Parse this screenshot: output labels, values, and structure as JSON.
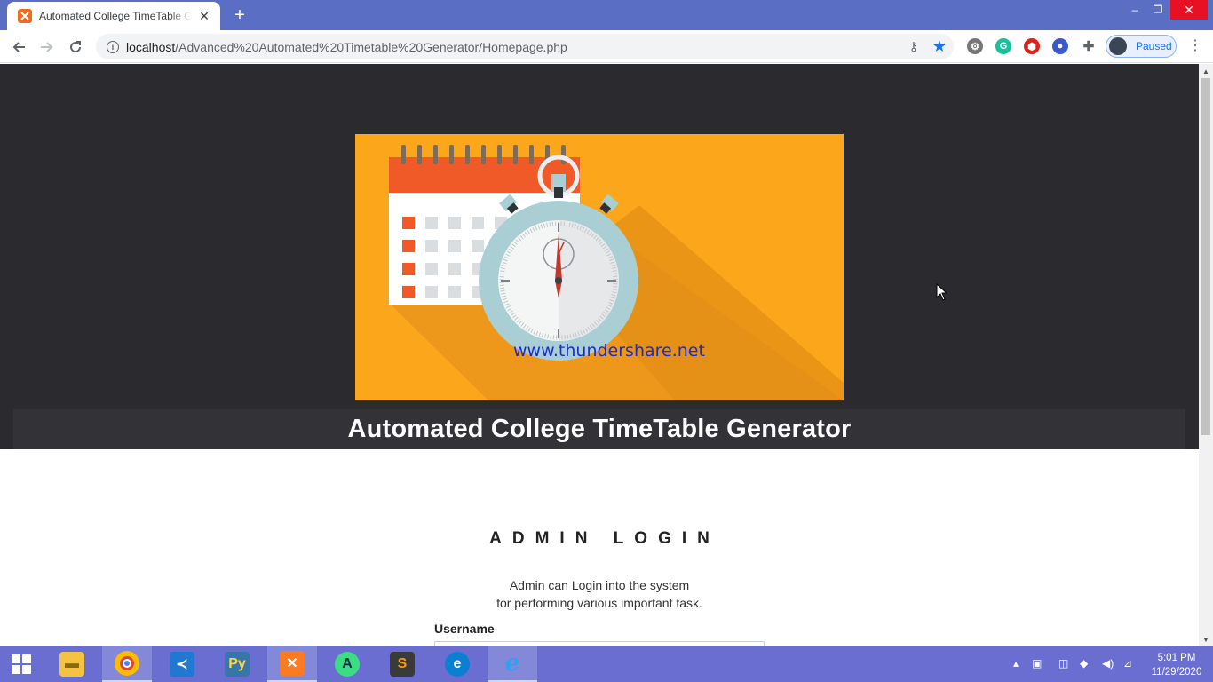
{
  "browser": {
    "tab_title": "Automated College TimeTable Generator",
    "url_host": "localhost",
    "url_path": "/Advanced%20Automated%20Timetable%20Generator/Homepage.php",
    "profile_label": "Paused",
    "icons": [
      "back-icon",
      "forward-icon",
      "reload-icon",
      "info-icon",
      "key-icon",
      "star-icon",
      "extensions-icon",
      "menu-icon"
    ]
  },
  "page": {
    "banner_watermark": "www.thundershare.net",
    "site_title": "Automated College TimeTable Generator",
    "login_heading": "ADMIN LOGIN",
    "login_desc_line1": "Admin can Login into the system",
    "login_desc_line2": "for performing various important task.",
    "username_label": "Username",
    "username_value": ""
  },
  "colors": {
    "hero_bg": "#2b2a2e",
    "banner_bg": "#fca61c",
    "tabbar_bg": "#5a6fc4",
    "taskbar_bg": "#6a6ed0",
    "calendar_header": "#ef5a28"
  },
  "taskbar": {
    "apps": [
      "file-explorer",
      "chrome",
      "vscode",
      "python",
      "xampp",
      "android-studio",
      "sublime-text",
      "edge",
      "internet-explorer"
    ],
    "time": "5:01 PM",
    "date": "11/29/2020"
  }
}
